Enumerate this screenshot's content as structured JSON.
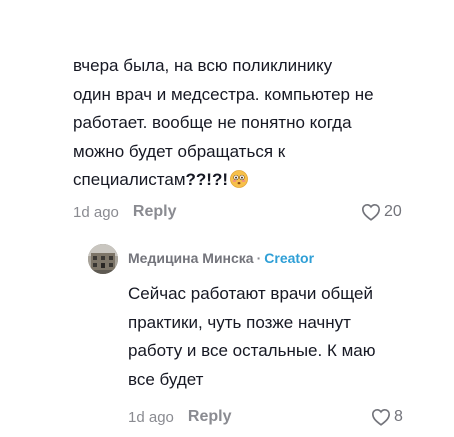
{
  "comment": {
    "text": "вчера была, на всю поликлинику\nодин врач и медсестра. компьютер не\nработает. вообще не понятно когда\nможно будет обращаться к\nспециалистам",
    "emphasis": "??!?!",
    "emoji": "flushed-face-emoji",
    "time": "1d ago",
    "reply_label": "Reply",
    "like_count": "20"
  },
  "reply": {
    "author": "Медицина Минска",
    "separator": "·",
    "badge": "Creator",
    "text": "Сейчас работают врачи общей\nпрактики, чуть позже начнут\nработу и все остальные. К маю\nвсе будет",
    "time": "1d ago",
    "reply_label": "Reply",
    "like_count": "8"
  },
  "colors": {
    "text": "#161823",
    "muted": "#8a8b91",
    "creator": "#2f9fd6"
  }
}
